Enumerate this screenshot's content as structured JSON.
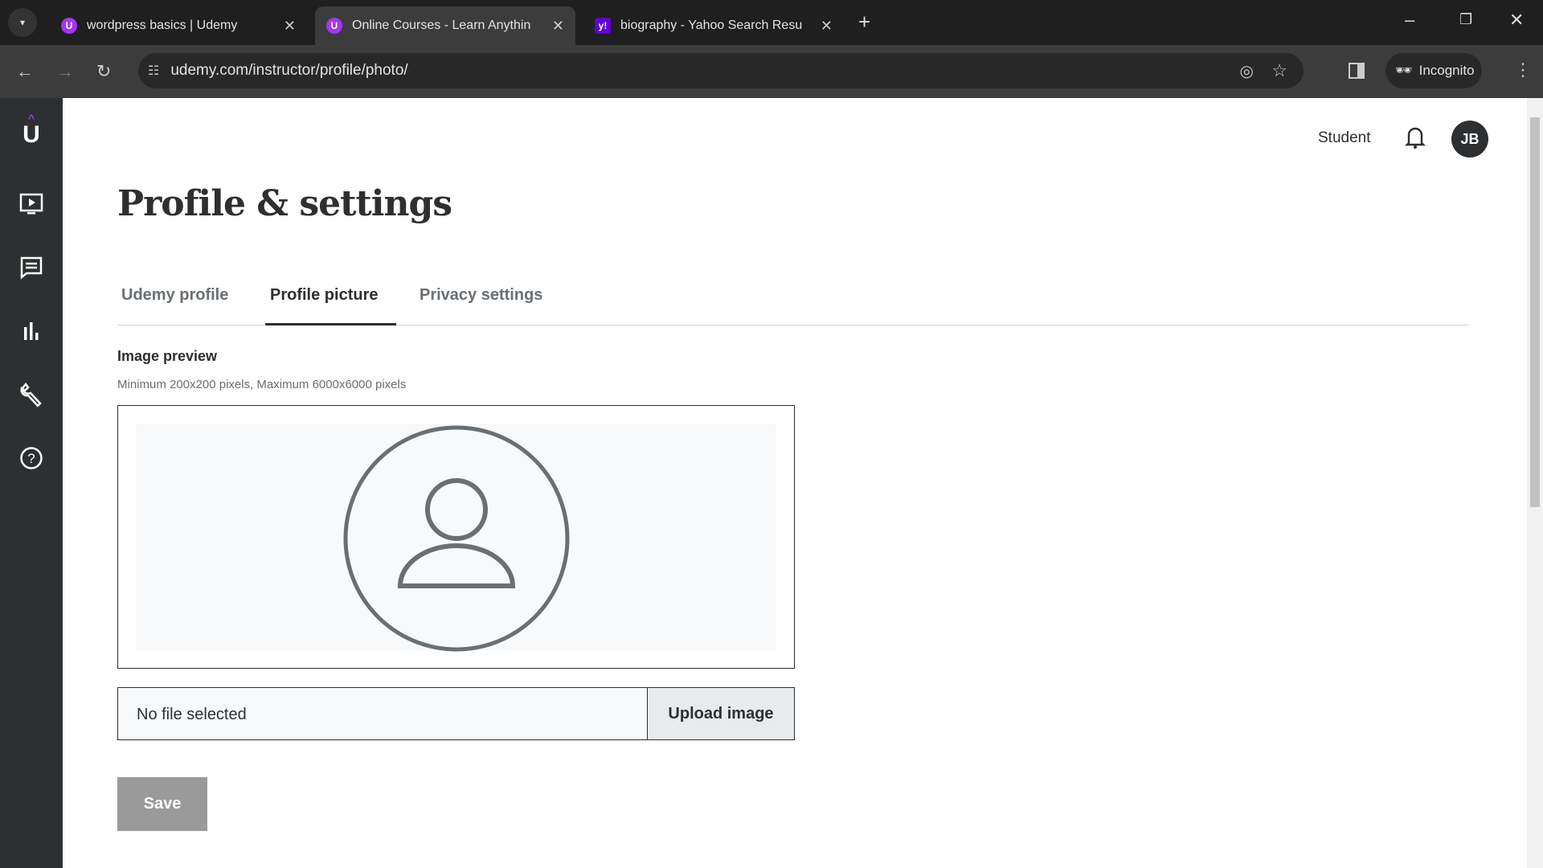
{
  "browser": {
    "tabs": [
      {
        "title": "wordpress basics | Udemy",
        "favicon": "U"
      },
      {
        "title": "Online Courses - Learn Anythin",
        "favicon": "U"
      },
      {
        "title": "biography - Yahoo Search Resu",
        "favicon": "y!"
      }
    ],
    "url": "udemy.com/instructor/profile/photo/",
    "incognito_label": "Incognito"
  },
  "header": {
    "student_link": "Student",
    "avatar_initials": "JB"
  },
  "sidebar": {
    "items": [
      "courses-icon",
      "communication-icon",
      "performance-icon",
      "tools-icon",
      "help-icon"
    ]
  },
  "page": {
    "title": "Profile & settings",
    "tabs": [
      {
        "label": "Udemy profile"
      },
      {
        "label": "Profile picture",
        "active": true
      },
      {
        "label": "Privacy settings"
      }
    ],
    "image_preview_label": "Image preview",
    "image_hint": "Minimum 200x200 pixels, Maximum 6000x6000 pixels",
    "file_status": "No file selected",
    "upload_label": "Upload image",
    "save_label": "Save"
  },
  "colors": {
    "brand": "#a435f0",
    "text": "#2d2f31",
    "sidebar": "#2d2f31",
    "save_disabled": "#9a9a9a"
  }
}
